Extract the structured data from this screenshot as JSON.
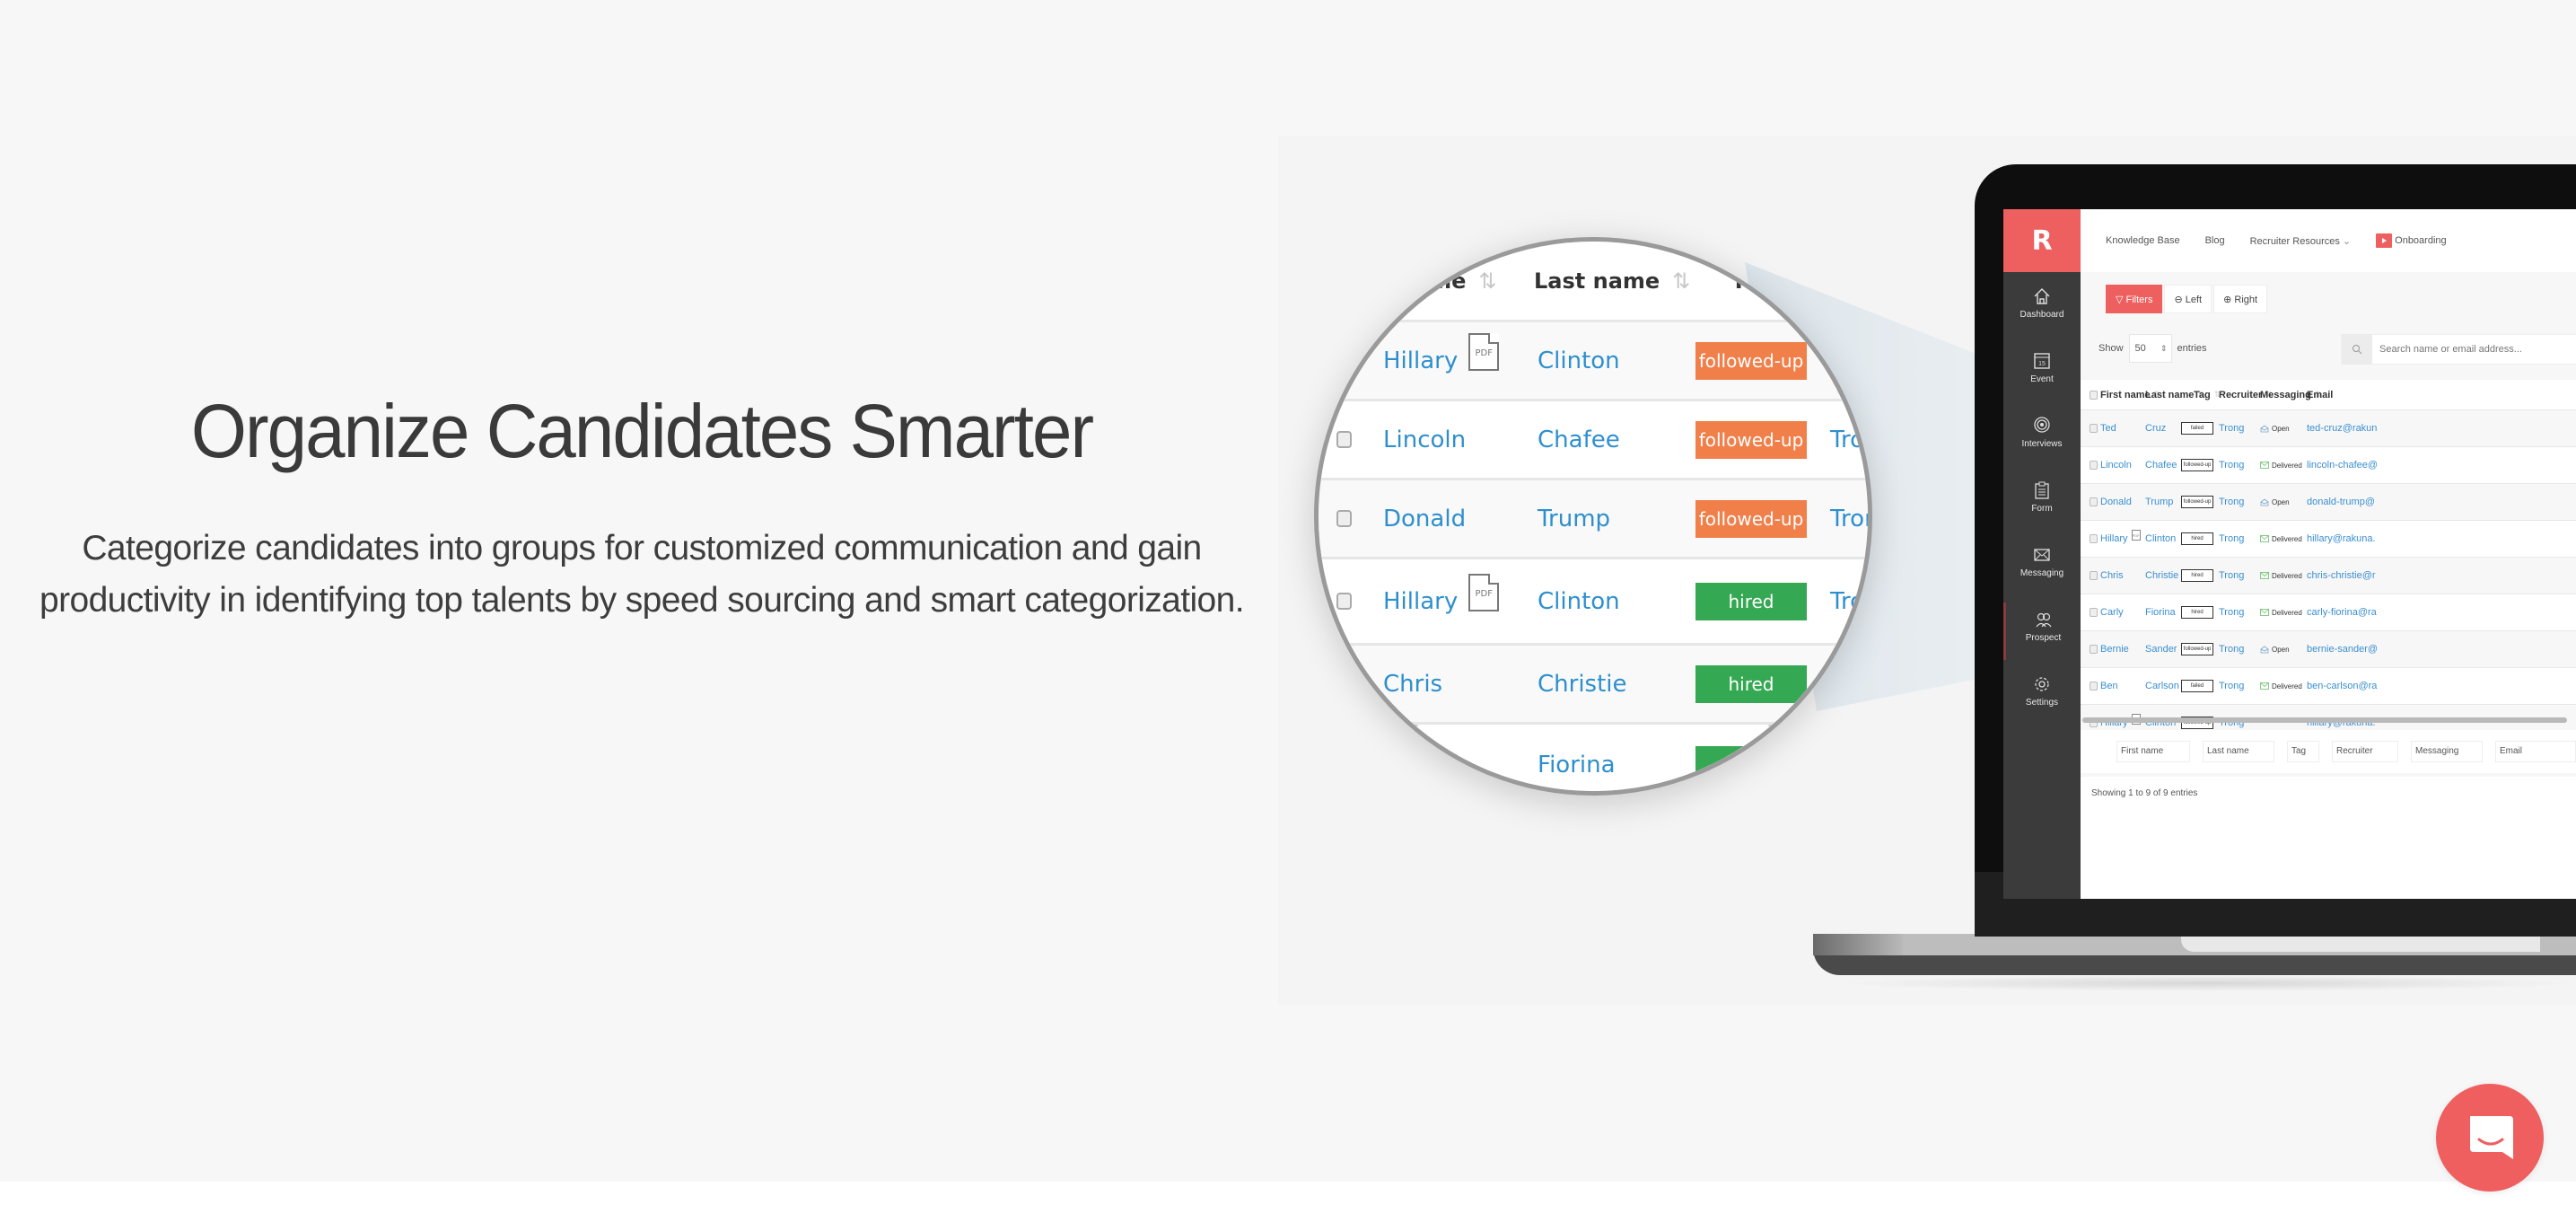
{
  "hero": {
    "title": "Organize Candidates Smarter",
    "description": "Categorize candidates into groups for customized communication and gain productivity in identifying top talents by speed sourcing and smart categorization."
  },
  "colors": {
    "brand": "#ee5f5f",
    "link": "#2e8fce",
    "tag_followed_up": "#f07f4a",
    "tag_hired": "#35a853",
    "sidebar": "#3b3b3b",
    "page_bg": "#f7f7f7"
  },
  "app": {
    "logo_letter": "R",
    "sidebar": [
      {
        "label": "Dashboard",
        "icon": "home-icon"
      },
      {
        "label": "Event",
        "icon": "calendar-icon",
        "icon_text": "15"
      },
      {
        "label": "Interviews",
        "icon": "target-icon"
      },
      {
        "label": "Form",
        "icon": "clipboard-icon"
      },
      {
        "label": "Messaging",
        "icon": "envelope-icon"
      },
      {
        "label": "Prospect",
        "icon": "people-icon",
        "active": true
      },
      {
        "label": "Settings",
        "icon": "gear-icon"
      }
    ],
    "topnav": {
      "knowledge_base": "Knowledge Base",
      "blog": "Blog",
      "recruiter_resources": "Recruiter Resources",
      "recruiter_resources_caret": "⌄",
      "onboarding": "Onboarding"
    },
    "toolbar": {
      "filters": "Filters",
      "left": "Left",
      "right": "Right"
    },
    "entries": {
      "show_label": "Show",
      "page_size": "50",
      "entries_label": "entries",
      "search_placeholder": "Search name or email address..."
    },
    "table": {
      "columns": [
        "First name",
        "Last name",
        "Tag",
        "Recruiter",
        "Messaging",
        "Email"
      ],
      "rows": [
        {
          "first": "Ted",
          "last": "Cruz",
          "pdf": false,
          "tag": "failed",
          "recruiter": "Trong",
          "messaging": "Open",
          "email": "ted-cruz@rakun"
        },
        {
          "first": "Lincoln",
          "last": "Chafee",
          "pdf": false,
          "tag": "followed-up",
          "recruiter": "Trong",
          "messaging": "Delivered",
          "email": "lincoln-chafee@"
        },
        {
          "first": "Donald",
          "last": "Trump",
          "pdf": false,
          "tag": "followed-up",
          "recruiter": "Trong",
          "messaging": "Open",
          "email": "donald-trump@"
        },
        {
          "first": "Hillary",
          "last": "Clinton",
          "pdf": true,
          "tag": "hired",
          "recruiter": "Trong",
          "messaging": "Delivered",
          "email": "hillary@rakuna."
        },
        {
          "first": "Chris",
          "last": "Christie",
          "pdf": false,
          "tag": "hired",
          "recruiter": "Trong",
          "messaging": "Delivered",
          "email": "chris-christie@r"
        },
        {
          "first": "Carly",
          "last": "Fiorina",
          "pdf": false,
          "tag": "hired",
          "recruiter": "Trong",
          "messaging": "Delivered",
          "email": "carly-fiorina@ra"
        },
        {
          "first": "Bernie",
          "last": "Sander",
          "pdf": false,
          "tag": "followed-up",
          "recruiter": "Trong",
          "messaging": "Open",
          "email": "bernie-sander@"
        },
        {
          "first": "Ben",
          "last": "Carlson",
          "pdf": false,
          "tag": "failed",
          "recruiter": "Trong",
          "messaging": "Delivered",
          "email": "ben-carlson@ra"
        },
        {
          "first": "Hillary",
          "last": "Clinton",
          "pdf": true,
          "tag": "followed-up",
          "recruiter": "Trong",
          "messaging": "",
          "email": "hillary@rakuna."
        }
      ],
      "footer_filters": [
        "First name",
        "Last name",
        "Tag",
        "Recruiter",
        "Messaging",
        "Email"
      ],
      "showing": "Showing 1 to 9 of 9 entries"
    }
  },
  "magnifier": {
    "headers": [
      "First name",
      "Last name",
      "Tag"
    ],
    "header_visible": {
      "first": "t name",
      "last": "Last name",
      "tag": "Ta"
    },
    "pdf_label": "PDF",
    "rows": [
      {
        "first": "Hillary",
        "last": "Clinton",
        "pdf": true,
        "tag": "followed-up",
        "tag_color": "#f07f4a",
        "recruiter": "",
        "checkbox": false
      },
      {
        "first": "Lincoln",
        "last": "Chafee",
        "pdf": false,
        "tag": "followed-up",
        "tag_color": "#f07f4a",
        "recruiter": "Tro",
        "checkbox": true
      },
      {
        "first": "Donald",
        "last": "Trump",
        "pdf": false,
        "tag": "followed-up",
        "tag_color": "#f07f4a",
        "recruiter": "Tron",
        "checkbox": true
      },
      {
        "first": "Hillary",
        "last": "Clinton",
        "pdf": true,
        "tag": "hired",
        "tag_color": "#35a853",
        "recruiter": "Tro",
        "checkbox": true
      },
      {
        "first": "Chris",
        "last": "Christie",
        "pdf": false,
        "tag": "hired",
        "tag_color": "#35a853",
        "recruiter": "",
        "checkbox": false
      },
      {
        "first": "",
        "last": "Fiorina",
        "pdf": false,
        "tag": "",
        "tag_color": "#35a853",
        "recruiter": "",
        "checkbox": false
      }
    ]
  },
  "chat_launcher": {
    "icon": "chat-bubble-icon"
  }
}
